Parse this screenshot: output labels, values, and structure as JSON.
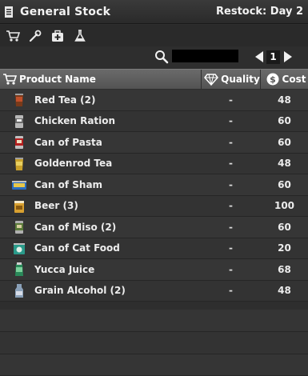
{
  "window": {
    "title": "General Stock",
    "restock": "Restock: Day 2"
  },
  "category_tabs": [
    {
      "icon": "shopping-cart-icon"
    },
    {
      "icon": "wrench-icon"
    },
    {
      "icon": "medical-kit-icon"
    },
    {
      "icon": "flask-icon"
    }
  ],
  "search": {
    "value": "",
    "placeholder": ""
  },
  "pager": {
    "page": "1"
  },
  "columns": {
    "product": "Product Name",
    "quality": "Quality",
    "cost": "Cost"
  },
  "items": [
    {
      "name": "Red Tea (2)",
      "quality": "-",
      "cost": "48",
      "icon": "red-tea-icon"
    },
    {
      "name": "Chicken Ration",
      "quality": "-",
      "cost": "60",
      "icon": "chicken-ration-icon"
    },
    {
      "name": "Can of Pasta",
      "quality": "-",
      "cost": "60",
      "icon": "can-of-pasta-icon"
    },
    {
      "name": "Goldenrod Tea",
      "quality": "-",
      "cost": "48",
      "icon": "goldenrod-tea-icon"
    },
    {
      "name": "Can of Sham",
      "quality": "-",
      "cost": "60",
      "icon": "can-of-sham-icon"
    },
    {
      "name": "Beer (3)",
      "quality": "-",
      "cost": "100",
      "icon": "beer-icon"
    },
    {
      "name": "Can of Miso (2)",
      "quality": "-",
      "cost": "60",
      "icon": "can-of-miso-icon"
    },
    {
      "name": "Can of Cat Food",
      "quality": "-",
      "cost": "20",
      "icon": "can-of-cat-food-icon"
    },
    {
      "name": "Yucca Juice",
      "quality": "-",
      "cost": "68",
      "icon": "yucca-juice-icon"
    },
    {
      "name": "Grain Alcohol (2)",
      "quality": "-",
      "cost": "48",
      "icon": "grain-alcohol-icon"
    }
  ]
}
